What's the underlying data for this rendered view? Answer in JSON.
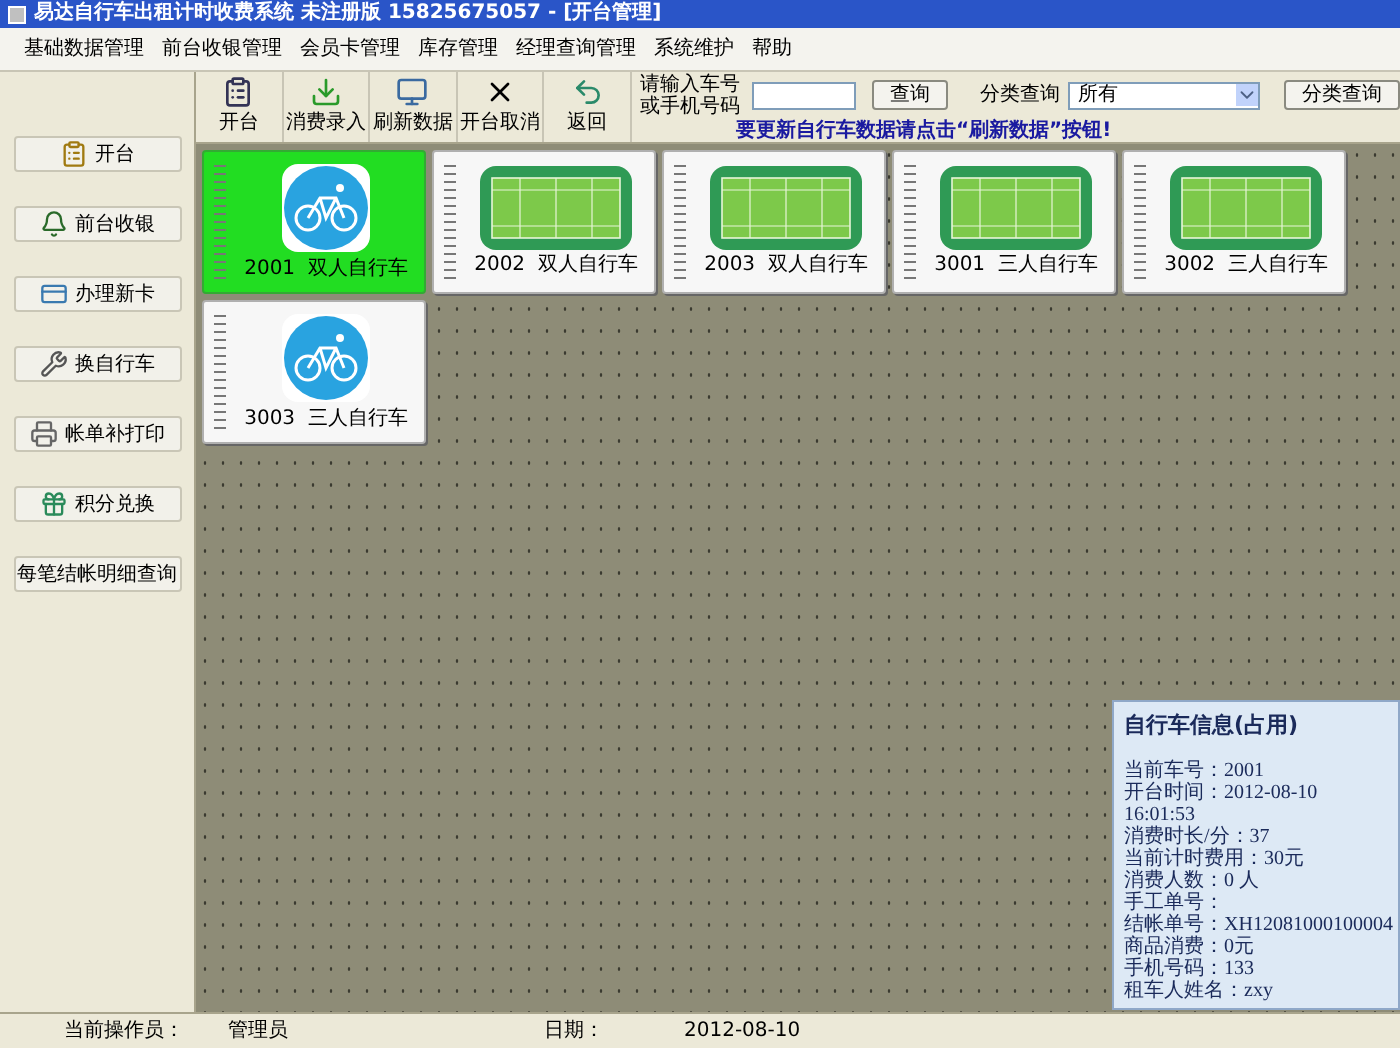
{
  "window": {
    "title": "易达自行车出租计时收费系统 未注册版 15825675057 - [开台管理]"
  },
  "menu": [
    "基础数据管理",
    "前台收银管理",
    "会员卡管理",
    "库存管理",
    "经理查询管理",
    "系统维护",
    "帮助"
  ],
  "toolbar": [
    {
      "label": "开台",
      "kind": "open"
    },
    {
      "label": "消费录入",
      "kind": "consume"
    },
    {
      "label": "刷新数据",
      "kind": "refresh"
    },
    {
      "label": "开台取消",
      "kind": "cancel"
    },
    {
      "label": "返回",
      "kind": "back"
    }
  ],
  "search": {
    "label": "请输入车号或手机号码",
    "button": "查询",
    "hint": "要更新自行车数据请点击“刷新数据”按钮!"
  },
  "category": {
    "label": "分类查询",
    "value": "所有",
    "button": "分类查询"
  },
  "sidebar": [
    {
      "label": "开台",
      "kind": "open"
    },
    {
      "label": "前台收银",
      "kind": "cashier"
    },
    {
      "label": "办理新卡",
      "kind": "card"
    },
    {
      "label": "换自行车",
      "kind": "swap"
    },
    {
      "label": "帐单补打印",
      "kind": "print"
    },
    {
      "label": "积分兑换",
      "kind": "points"
    },
    {
      "label": "每笔结帐明细查询",
      "kind": "plain"
    }
  ],
  "bikes": [
    {
      "label": "2001  双人自行车",
      "kind": "bike",
      "selected": true
    },
    {
      "label": "2002  双人自行车",
      "kind": "court",
      "selected": false
    },
    {
      "label": "2003  双人自行车",
      "kind": "court",
      "selected": false
    },
    {
      "label": "3001  三人自行车",
      "kind": "court",
      "selected": false
    },
    {
      "label": "3002  三人自行车",
      "kind": "court",
      "selected": false
    },
    {
      "label": "3003  三人自行车",
      "kind": "bike",
      "selected": false
    }
  ],
  "info": {
    "title": "自行车信息(占用)",
    "lines": [
      "当前车号：2001",
      "开台时间：2012-08-10",
      "16:01:53",
      "消费时长/分：37",
      "当前计时费用：30元",
      "消费人数：0 人",
      "手工单号：",
      "结帐单号：XH12081000100004",
      "商品消费：0元",
      "手机号码：133",
      "租车人姓名：zxy"
    ]
  },
  "status_bar": {
    "operator_label": "当前操作员：",
    "operator": "管理员",
    "date_label": "日期：",
    "date": "2012-08-10"
  }
}
